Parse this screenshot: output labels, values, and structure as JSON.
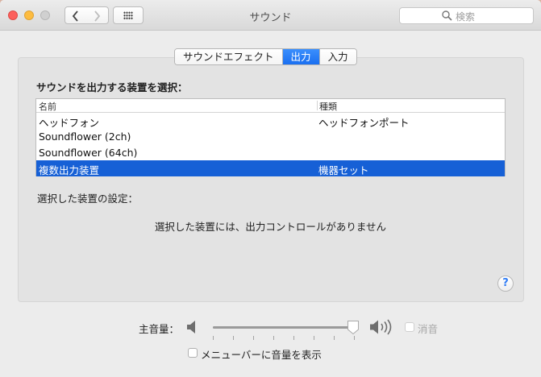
{
  "window": {
    "title": "サウンド"
  },
  "toolbar": {
    "search_placeholder": "検索"
  },
  "tabs": [
    {
      "label": "サウンドエフェクト",
      "active": false
    },
    {
      "label": "出力",
      "active": true
    },
    {
      "label": "入力",
      "active": false
    }
  ],
  "output": {
    "section_label": "サウンドを出力する装置を選択：",
    "columns": {
      "name": "名前",
      "type": "種類"
    },
    "devices": [
      {
        "name": "ヘッドフォン",
        "type": "ヘッドフォンポート",
        "selected": false
      },
      {
        "name": "Soundflower (2ch)",
        "type": "",
        "selected": false
      },
      {
        "name": "Soundflower (64ch)",
        "type": "",
        "selected": false
      },
      {
        "name": "複数出力装置",
        "type": "機器セット",
        "selected": true
      }
    ],
    "settings_label": "選択した装置の設定：",
    "no_controls_message": "選択した装置には、出力コントロールがありません"
  },
  "help": {
    "glyph": "?"
  },
  "volume": {
    "label": "主音量：",
    "level_fraction": 0.99,
    "mute_label": "消音",
    "mute_checked": false,
    "mute_enabled": false
  },
  "menubar_option": {
    "label": "メニューバーに音量を表示",
    "checked": false
  },
  "colors": {
    "accent": "#1660d6",
    "tab_active": "#2a7ff7",
    "help_glyph": "#2f7cf6",
    "close": "#fc605c",
    "minimize": "#fdbc40",
    "zoom_disabled": "#d0d0d0"
  },
  "icons": {
    "close": "close-icon",
    "minimize": "minimize-icon",
    "zoom": "zoom-icon",
    "back": "chevron-left-icon",
    "forward": "chevron-right-icon",
    "show_all": "grid-icon",
    "search": "search-icon",
    "volume_low": "speaker-low-icon",
    "volume_high": "speaker-high-icon"
  }
}
